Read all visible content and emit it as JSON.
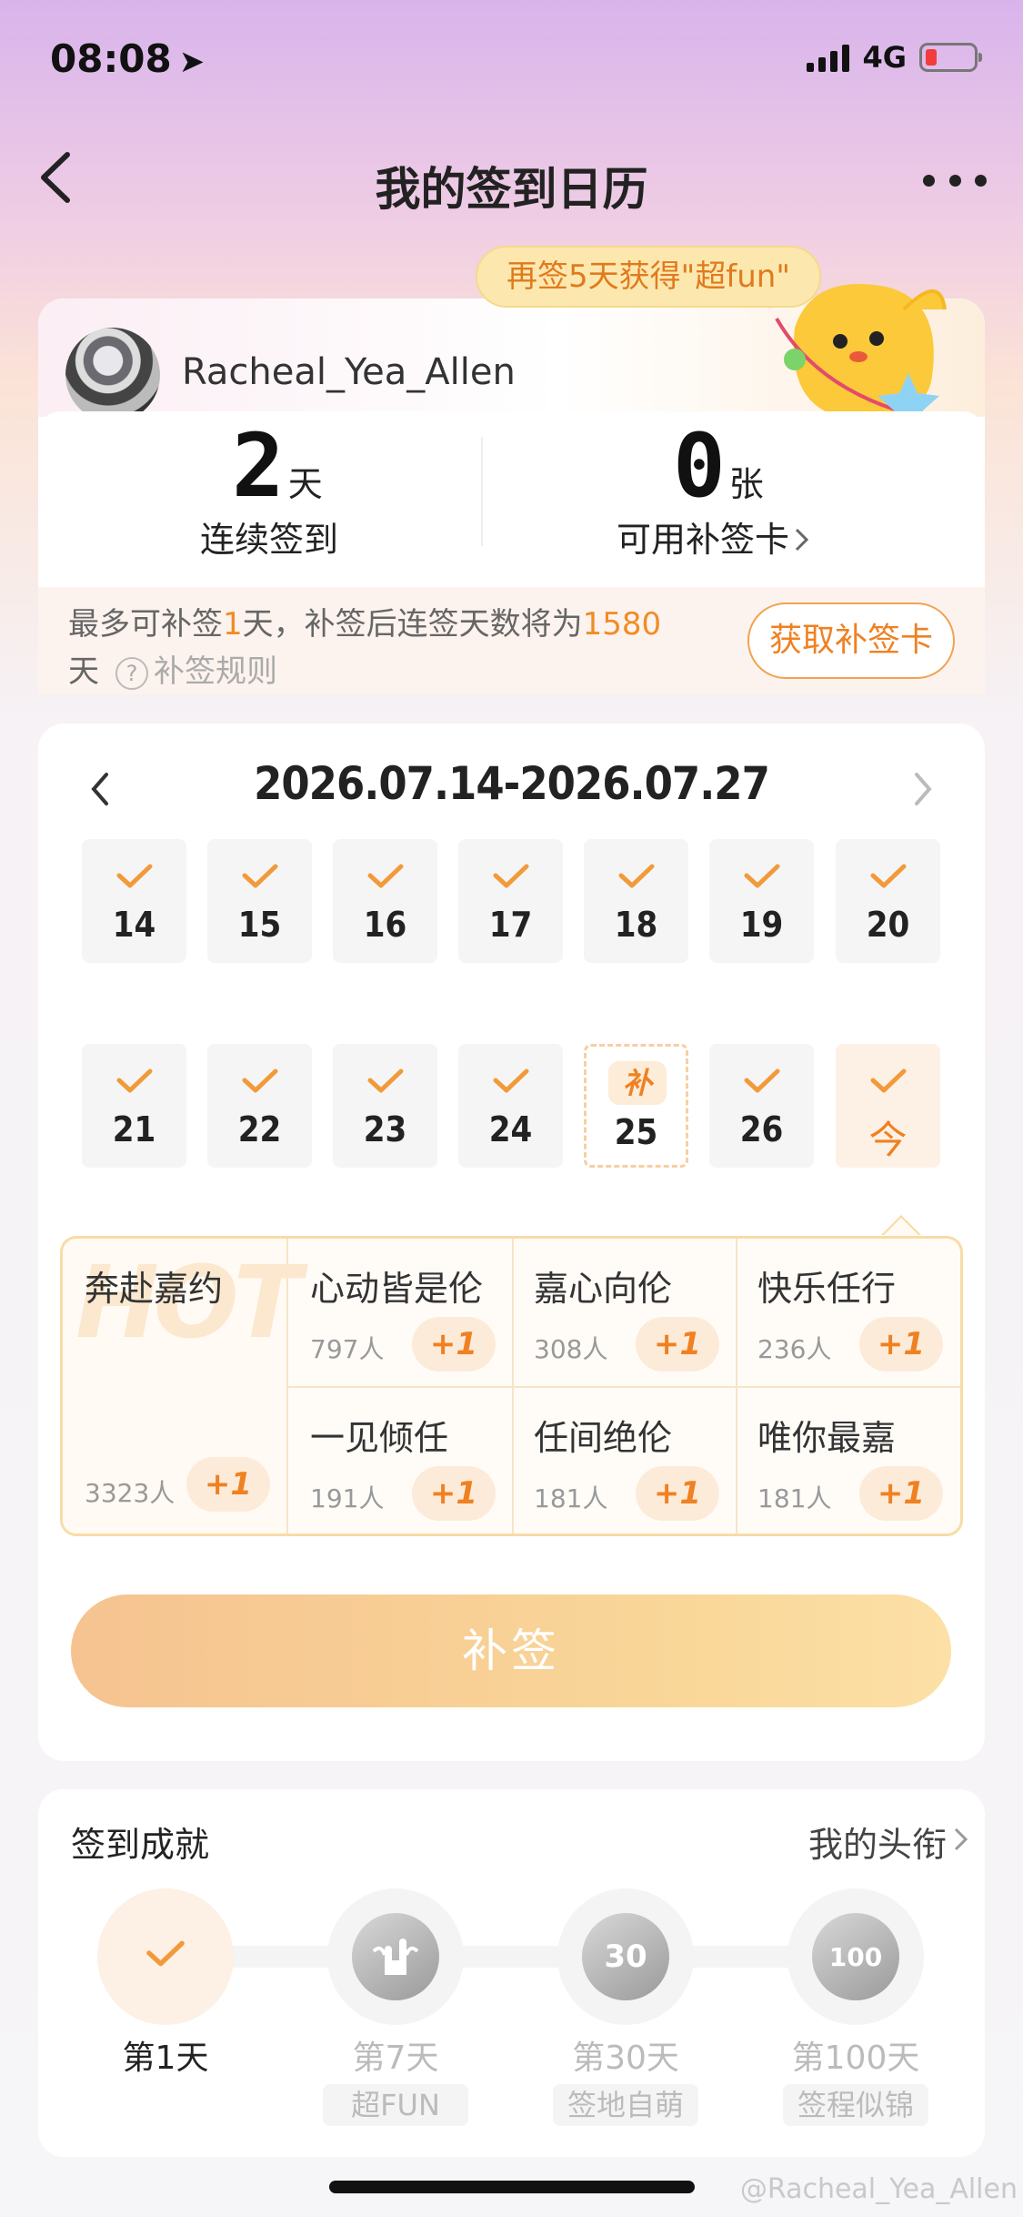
{
  "status_bar": {
    "time": "08:08",
    "network": "4G"
  },
  "nav": {
    "title": "我的签到日历"
  },
  "user": {
    "name": "Racheal_Yea_Allen",
    "tip": "再签5天获得\"超fun\""
  },
  "stats": {
    "streak_value": "2",
    "streak_unit": "天",
    "streak_label": "连续签到",
    "cards_value": "0",
    "cards_unit": "张",
    "cards_label": "可用补签卡"
  },
  "makeup_info": {
    "prefix": "最多可补签",
    "count": "1",
    "mid": "天，补签后连签天数将为",
    "days": "1580",
    "suffix": "天",
    "rules_label": "补签规则",
    "get_card_label": "获取补签卡"
  },
  "calendar": {
    "range": "2026.07.14-2026.07.27",
    "makeup_tag": "补",
    "today_label": "今",
    "days": [
      "14",
      "15",
      "16",
      "17",
      "18",
      "19",
      "20",
      "21",
      "22",
      "23",
      "24",
      "25",
      "26",
      "今"
    ]
  },
  "tags": [
    {
      "name": "奔赴嘉约",
      "count": "3323人",
      "plus": "+1"
    },
    {
      "name": "心动皆是伦",
      "count": "797人",
      "plus": "+1"
    },
    {
      "name": "嘉心向伦",
      "count": "308人",
      "plus": "+1"
    },
    {
      "name": "快乐任行",
      "count": "236人",
      "plus": "+1"
    },
    {
      "name": "一见倾任",
      "count": "191人",
      "plus": "+1"
    },
    {
      "name": "任间绝伦",
      "count": "181人",
      "plus": "+1"
    },
    {
      "name": "唯你最嘉",
      "count": "181人",
      "plus": "+1"
    }
  ],
  "tag_hot": "HOT",
  "makeup_button": "补签",
  "achievements": {
    "title": "签到成就",
    "link": "我的头衔",
    "items": [
      {
        "label": "第1天",
        "sub": ""
      },
      {
        "label": "第7天",
        "sub": "超FUN"
      },
      {
        "label": "第30天",
        "sub": "签地自萌"
      },
      {
        "label": "第100天",
        "sub": "签程似锦"
      }
    ],
    "badge_30": "30",
    "badge_100": "100"
  },
  "watermark": "@Racheal_Yea_Allen",
  "colors": {
    "accent": "#ef8122",
    "check": "#f29a3a"
  }
}
